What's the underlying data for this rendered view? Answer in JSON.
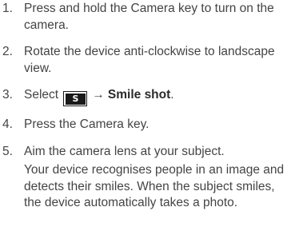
{
  "steps": [
    {
      "number": "1.",
      "text": "Press and hold the Camera key to turn on the camera."
    },
    {
      "number": "2.",
      "text": "Rotate the device anti-clockwise to landscape view."
    },
    {
      "number": "3.",
      "prefix": "Select",
      "icon": {
        "name": "shooting-mode-icon",
        "letter": "S"
      },
      "arrow": "→",
      "target": "Smile shot",
      "suffix": "."
    },
    {
      "number": "4.",
      "text": "Press the Camera key."
    },
    {
      "number": "5.",
      "text": "Aim the camera lens at your subject.",
      "description": "Your device recognises people in an image and detects their smiles. When the subject smiles, the device automatically takes a photo."
    }
  ]
}
